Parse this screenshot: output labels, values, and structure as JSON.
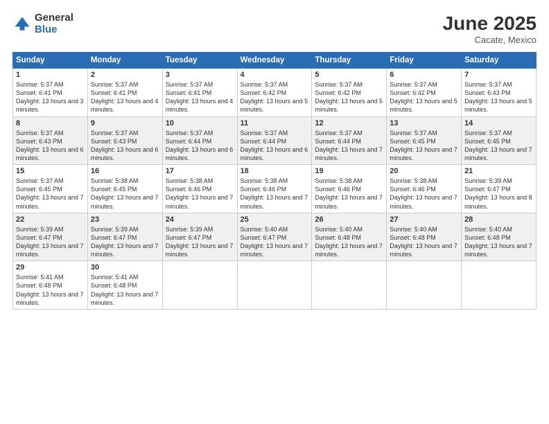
{
  "header": {
    "logo_general": "General",
    "logo_blue": "Blue",
    "month": "June 2025",
    "location": "Cacate, Mexico"
  },
  "weekdays": [
    "Sunday",
    "Monday",
    "Tuesday",
    "Wednesday",
    "Thursday",
    "Friday",
    "Saturday"
  ],
  "weeks": [
    [
      {
        "day": 1,
        "sunrise": "5:37 AM",
        "sunset": "6:41 PM",
        "daylight": "13 hours and 3 minutes."
      },
      {
        "day": 2,
        "sunrise": "5:37 AM",
        "sunset": "6:41 PM",
        "daylight": "13 hours and 4 minutes."
      },
      {
        "day": 3,
        "sunrise": "5:37 AM",
        "sunset": "6:41 PM",
        "daylight": "13 hours and 4 minutes."
      },
      {
        "day": 4,
        "sunrise": "5:37 AM",
        "sunset": "6:42 PM",
        "daylight": "13 hours and 5 minutes."
      },
      {
        "day": 5,
        "sunrise": "5:37 AM",
        "sunset": "6:42 PM",
        "daylight": "13 hours and 5 minutes."
      },
      {
        "day": 6,
        "sunrise": "5:37 AM",
        "sunset": "6:42 PM",
        "daylight": "13 hours and 5 minutes."
      },
      {
        "day": 7,
        "sunrise": "5:37 AM",
        "sunset": "6:43 PM",
        "daylight": "13 hours and 5 minutes."
      }
    ],
    [
      {
        "day": 8,
        "sunrise": "5:37 AM",
        "sunset": "6:43 PM",
        "daylight": "13 hours and 6 minutes."
      },
      {
        "day": 9,
        "sunrise": "5:37 AM",
        "sunset": "6:43 PM",
        "daylight": "13 hours and 6 minutes."
      },
      {
        "day": 10,
        "sunrise": "5:37 AM",
        "sunset": "6:44 PM",
        "daylight": "13 hours and 6 minutes."
      },
      {
        "day": 11,
        "sunrise": "5:37 AM",
        "sunset": "6:44 PM",
        "daylight": "13 hours and 6 minutes."
      },
      {
        "day": 12,
        "sunrise": "5:37 AM",
        "sunset": "6:44 PM",
        "daylight": "13 hours and 7 minutes."
      },
      {
        "day": 13,
        "sunrise": "5:37 AM",
        "sunset": "6:45 PM",
        "daylight": "13 hours and 7 minutes."
      },
      {
        "day": 14,
        "sunrise": "5:37 AM",
        "sunset": "6:45 PM",
        "daylight": "13 hours and 7 minutes."
      }
    ],
    [
      {
        "day": 15,
        "sunrise": "5:37 AM",
        "sunset": "6:45 PM",
        "daylight": "13 hours and 7 minutes."
      },
      {
        "day": 16,
        "sunrise": "5:38 AM",
        "sunset": "6:45 PM",
        "daylight": "13 hours and 7 minutes."
      },
      {
        "day": 17,
        "sunrise": "5:38 AM",
        "sunset": "6:46 PM",
        "daylight": "13 hours and 7 minutes."
      },
      {
        "day": 18,
        "sunrise": "5:38 AM",
        "sunset": "6:46 PM",
        "daylight": "13 hours and 7 minutes."
      },
      {
        "day": 19,
        "sunrise": "5:38 AM",
        "sunset": "6:46 PM",
        "daylight": "13 hours and 7 minutes."
      },
      {
        "day": 20,
        "sunrise": "5:38 AM",
        "sunset": "6:46 PM",
        "daylight": "13 hours and 7 minutes."
      },
      {
        "day": 21,
        "sunrise": "5:39 AM",
        "sunset": "6:47 PM",
        "daylight": "13 hours and 8 minutes."
      }
    ],
    [
      {
        "day": 22,
        "sunrise": "5:39 AM",
        "sunset": "6:47 PM",
        "daylight": "13 hours and 7 minutes."
      },
      {
        "day": 23,
        "sunrise": "5:39 AM",
        "sunset": "6:47 PM",
        "daylight": "13 hours and 7 minutes."
      },
      {
        "day": 24,
        "sunrise": "5:39 AM",
        "sunset": "6:47 PM",
        "daylight": "13 hours and 7 minutes."
      },
      {
        "day": 25,
        "sunrise": "5:40 AM",
        "sunset": "6:47 PM",
        "daylight": "13 hours and 7 minutes."
      },
      {
        "day": 26,
        "sunrise": "5:40 AM",
        "sunset": "6:48 PM",
        "daylight": "13 hours and 7 minutes."
      },
      {
        "day": 27,
        "sunrise": "5:40 AM",
        "sunset": "6:48 PM",
        "daylight": "13 hours and 7 minutes."
      },
      {
        "day": 28,
        "sunrise": "5:40 AM",
        "sunset": "6:48 PM",
        "daylight": "13 hours and 7 minutes."
      }
    ],
    [
      {
        "day": 29,
        "sunrise": "5:41 AM",
        "sunset": "6:48 PM",
        "daylight": "13 hours and 7 minutes."
      },
      {
        "day": 30,
        "sunrise": "5:41 AM",
        "sunset": "6:48 PM",
        "daylight": "13 hours and 7 minutes."
      },
      null,
      null,
      null,
      null,
      null
    ]
  ],
  "labels": {
    "sunrise": "Sunrise:",
    "sunset": "Sunset:",
    "daylight": "Daylight:"
  }
}
